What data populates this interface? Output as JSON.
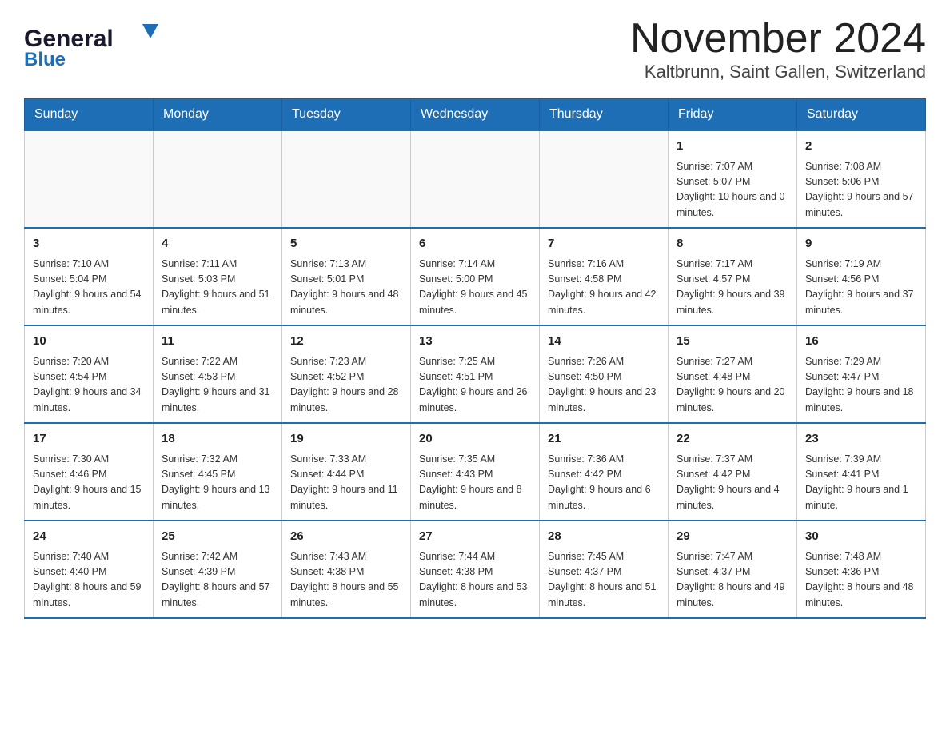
{
  "header": {
    "logo_general": "General",
    "logo_blue": "Blue",
    "month_title": "November 2024",
    "location": "Kaltbrunn, Saint Gallen, Switzerland"
  },
  "weekdays": [
    "Sunday",
    "Monday",
    "Tuesday",
    "Wednesday",
    "Thursday",
    "Friday",
    "Saturday"
  ],
  "weeks": [
    [
      {
        "day": "",
        "sunrise": "",
        "sunset": "",
        "daylight": ""
      },
      {
        "day": "",
        "sunrise": "",
        "sunset": "",
        "daylight": ""
      },
      {
        "day": "",
        "sunrise": "",
        "sunset": "",
        "daylight": ""
      },
      {
        "day": "",
        "sunrise": "",
        "sunset": "",
        "daylight": ""
      },
      {
        "day": "",
        "sunrise": "",
        "sunset": "",
        "daylight": ""
      },
      {
        "day": "1",
        "sunrise": "Sunrise: 7:07 AM",
        "sunset": "Sunset: 5:07 PM",
        "daylight": "Daylight: 10 hours and 0 minutes."
      },
      {
        "day": "2",
        "sunrise": "Sunrise: 7:08 AM",
        "sunset": "Sunset: 5:06 PM",
        "daylight": "Daylight: 9 hours and 57 minutes."
      }
    ],
    [
      {
        "day": "3",
        "sunrise": "Sunrise: 7:10 AM",
        "sunset": "Sunset: 5:04 PM",
        "daylight": "Daylight: 9 hours and 54 minutes."
      },
      {
        "day": "4",
        "sunrise": "Sunrise: 7:11 AM",
        "sunset": "Sunset: 5:03 PM",
        "daylight": "Daylight: 9 hours and 51 minutes."
      },
      {
        "day": "5",
        "sunrise": "Sunrise: 7:13 AM",
        "sunset": "Sunset: 5:01 PM",
        "daylight": "Daylight: 9 hours and 48 minutes."
      },
      {
        "day": "6",
        "sunrise": "Sunrise: 7:14 AM",
        "sunset": "Sunset: 5:00 PM",
        "daylight": "Daylight: 9 hours and 45 minutes."
      },
      {
        "day": "7",
        "sunrise": "Sunrise: 7:16 AM",
        "sunset": "Sunset: 4:58 PM",
        "daylight": "Daylight: 9 hours and 42 minutes."
      },
      {
        "day": "8",
        "sunrise": "Sunrise: 7:17 AM",
        "sunset": "Sunset: 4:57 PM",
        "daylight": "Daylight: 9 hours and 39 minutes."
      },
      {
        "day": "9",
        "sunrise": "Sunrise: 7:19 AM",
        "sunset": "Sunset: 4:56 PM",
        "daylight": "Daylight: 9 hours and 37 minutes."
      }
    ],
    [
      {
        "day": "10",
        "sunrise": "Sunrise: 7:20 AM",
        "sunset": "Sunset: 4:54 PM",
        "daylight": "Daylight: 9 hours and 34 minutes."
      },
      {
        "day": "11",
        "sunrise": "Sunrise: 7:22 AM",
        "sunset": "Sunset: 4:53 PM",
        "daylight": "Daylight: 9 hours and 31 minutes."
      },
      {
        "day": "12",
        "sunrise": "Sunrise: 7:23 AM",
        "sunset": "Sunset: 4:52 PM",
        "daylight": "Daylight: 9 hours and 28 minutes."
      },
      {
        "day": "13",
        "sunrise": "Sunrise: 7:25 AM",
        "sunset": "Sunset: 4:51 PM",
        "daylight": "Daylight: 9 hours and 26 minutes."
      },
      {
        "day": "14",
        "sunrise": "Sunrise: 7:26 AM",
        "sunset": "Sunset: 4:50 PM",
        "daylight": "Daylight: 9 hours and 23 minutes."
      },
      {
        "day": "15",
        "sunrise": "Sunrise: 7:27 AM",
        "sunset": "Sunset: 4:48 PM",
        "daylight": "Daylight: 9 hours and 20 minutes."
      },
      {
        "day": "16",
        "sunrise": "Sunrise: 7:29 AM",
        "sunset": "Sunset: 4:47 PM",
        "daylight": "Daylight: 9 hours and 18 minutes."
      }
    ],
    [
      {
        "day": "17",
        "sunrise": "Sunrise: 7:30 AM",
        "sunset": "Sunset: 4:46 PM",
        "daylight": "Daylight: 9 hours and 15 minutes."
      },
      {
        "day": "18",
        "sunrise": "Sunrise: 7:32 AM",
        "sunset": "Sunset: 4:45 PM",
        "daylight": "Daylight: 9 hours and 13 minutes."
      },
      {
        "day": "19",
        "sunrise": "Sunrise: 7:33 AM",
        "sunset": "Sunset: 4:44 PM",
        "daylight": "Daylight: 9 hours and 11 minutes."
      },
      {
        "day": "20",
        "sunrise": "Sunrise: 7:35 AM",
        "sunset": "Sunset: 4:43 PM",
        "daylight": "Daylight: 9 hours and 8 minutes."
      },
      {
        "day": "21",
        "sunrise": "Sunrise: 7:36 AM",
        "sunset": "Sunset: 4:42 PM",
        "daylight": "Daylight: 9 hours and 6 minutes."
      },
      {
        "day": "22",
        "sunrise": "Sunrise: 7:37 AM",
        "sunset": "Sunset: 4:42 PM",
        "daylight": "Daylight: 9 hours and 4 minutes."
      },
      {
        "day": "23",
        "sunrise": "Sunrise: 7:39 AM",
        "sunset": "Sunset: 4:41 PM",
        "daylight": "Daylight: 9 hours and 1 minute."
      }
    ],
    [
      {
        "day": "24",
        "sunrise": "Sunrise: 7:40 AM",
        "sunset": "Sunset: 4:40 PM",
        "daylight": "Daylight: 8 hours and 59 minutes."
      },
      {
        "day": "25",
        "sunrise": "Sunrise: 7:42 AM",
        "sunset": "Sunset: 4:39 PM",
        "daylight": "Daylight: 8 hours and 57 minutes."
      },
      {
        "day": "26",
        "sunrise": "Sunrise: 7:43 AM",
        "sunset": "Sunset: 4:38 PM",
        "daylight": "Daylight: 8 hours and 55 minutes."
      },
      {
        "day": "27",
        "sunrise": "Sunrise: 7:44 AM",
        "sunset": "Sunset: 4:38 PM",
        "daylight": "Daylight: 8 hours and 53 minutes."
      },
      {
        "day": "28",
        "sunrise": "Sunrise: 7:45 AM",
        "sunset": "Sunset: 4:37 PM",
        "daylight": "Daylight: 8 hours and 51 minutes."
      },
      {
        "day": "29",
        "sunrise": "Sunrise: 7:47 AM",
        "sunset": "Sunset: 4:37 PM",
        "daylight": "Daylight: 8 hours and 49 minutes."
      },
      {
        "day": "30",
        "sunrise": "Sunrise: 7:48 AM",
        "sunset": "Sunset: 4:36 PM",
        "daylight": "Daylight: 8 hours and 48 minutes."
      }
    ]
  ]
}
